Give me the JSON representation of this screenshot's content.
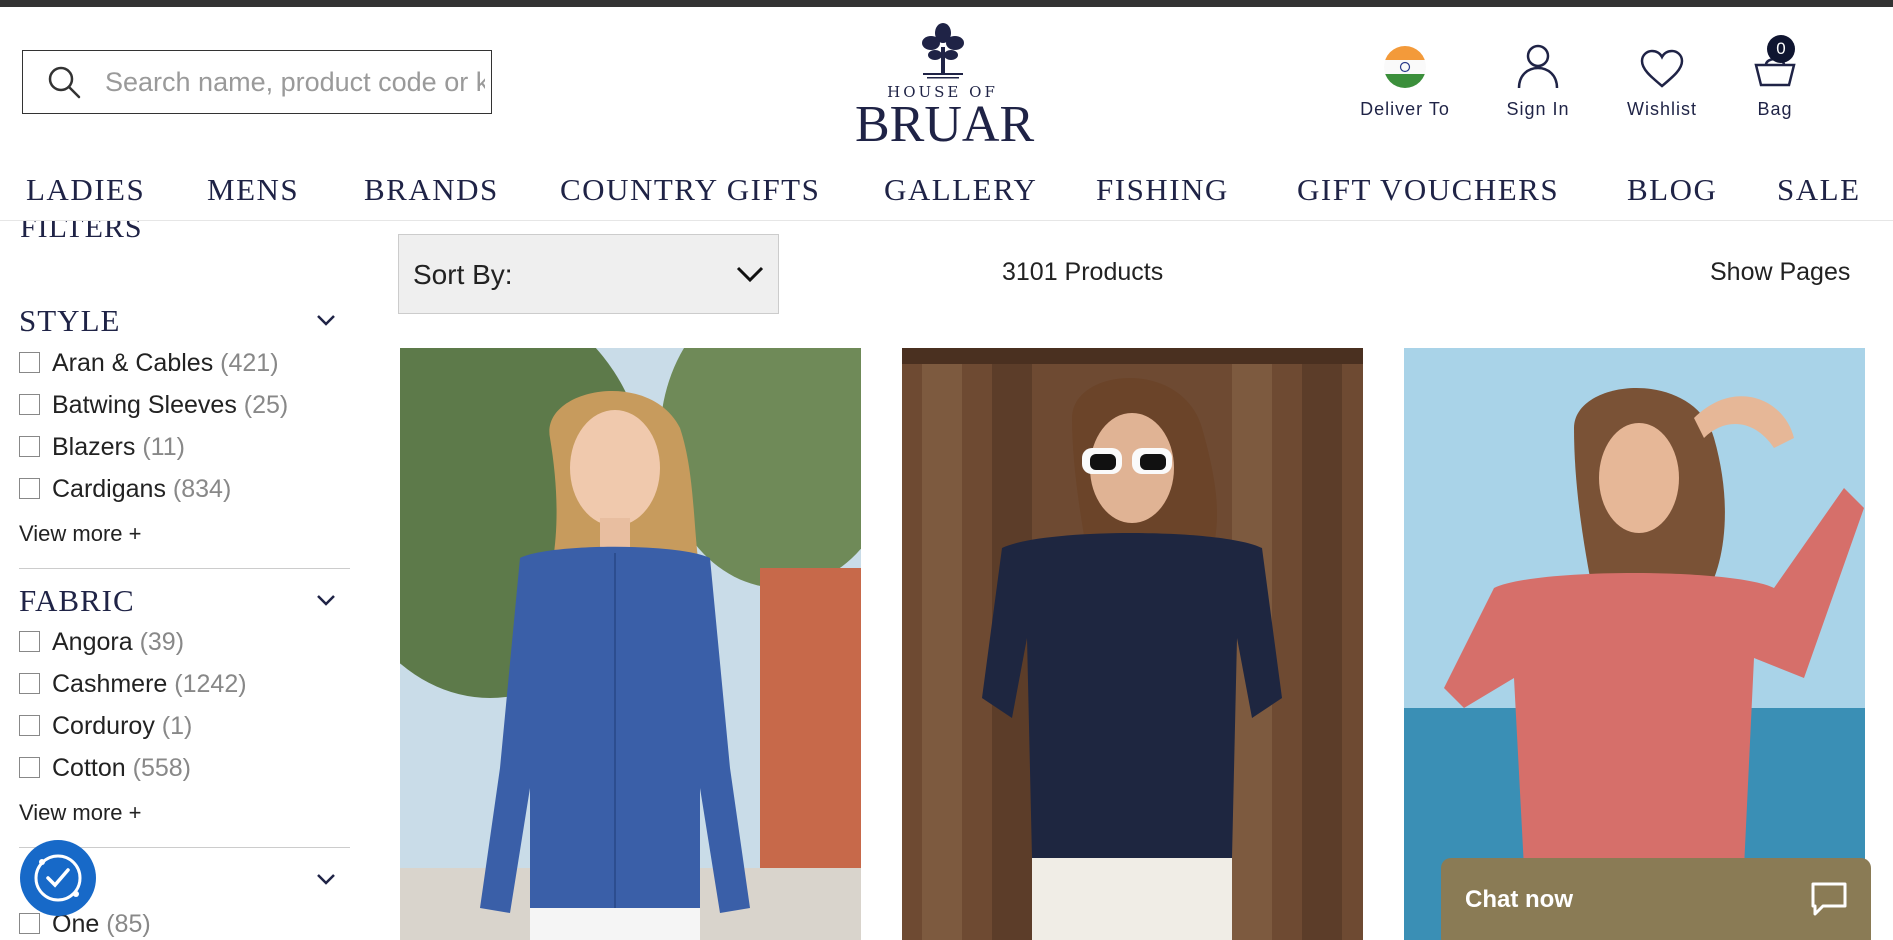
{
  "header": {
    "search_placeholder": "Search name, product code or keyword",
    "logo_line1": "HOUSE OF",
    "logo_line2": "BRUAR",
    "deliver_label": "Deliver To",
    "signin_label": "Sign In",
    "wishlist_label": "Wishlist",
    "bag_label": "Bag",
    "bag_count": "0"
  },
  "nav": [
    "LADIES",
    "MENS",
    "BRANDS",
    "COUNTRY GIFTS",
    "GALLERY",
    "FISHING",
    "GIFT VOUCHERS",
    "BLOG",
    "SALE"
  ],
  "sidebar": {
    "filters_title": "FILTERS",
    "sections": [
      {
        "title": "STYLE",
        "options": [
          {
            "label": "Aran & Cables",
            "count": "(421)"
          },
          {
            "label": "Batwing Sleeves",
            "count": "(25)"
          },
          {
            "label": "Blazers",
            "count": "(11)"
          },
          {
            "label": "Cardigans",
            "count": "(834)"
          }
        ],
        "more": "View more +"
      },
      {
        "title": "FABRIC",
        "options": [
          {
            "label": "Angora",
            "count": "(39)"
          },
          {
            "label": "Cashmere",
            "count": "(1242)"
          },
          {
            "label": "Corduroy",
            "count": "(1)"
          },
          {
            "label": "Cotton",
            "count": "(558)"
          }
        ],
        "more": "View more +"
      },
      {
        "title": "",
        "options": [
          {
            "label": "One",
            "count": "(85)"
          }
        ]
      }
    ]
  },
  "toolbar": {
    "sort_label": "Sort By:",
    "product_count": "3101 Products",
    "show_pages": "Show Pages"
  },
  "products": [
    {
      "alt": "Woman in blue cardigan",
      "garment_color": "#3a5fa8",
      "background_color": "#5d7a4a"
    },
    {
      "alt": "Woman in navy henley jumper",
      "garment_color": "#1e2640",
      "background_color": "#6e4a32"
    },
    {
      "alt": "Woman in coral pointelle jumper",
      "garment_color": "#d66f6a",
      "background_color": "#a9d3e8"
    }
  ],
  "chat": {
    "label": "Chat now"
  },
  "colors": {
    "brand_navy": "#1f2346",
    "chat_bg": "#8a7b55",
    "accessibility_blue": "#1769c8"
  }
}
